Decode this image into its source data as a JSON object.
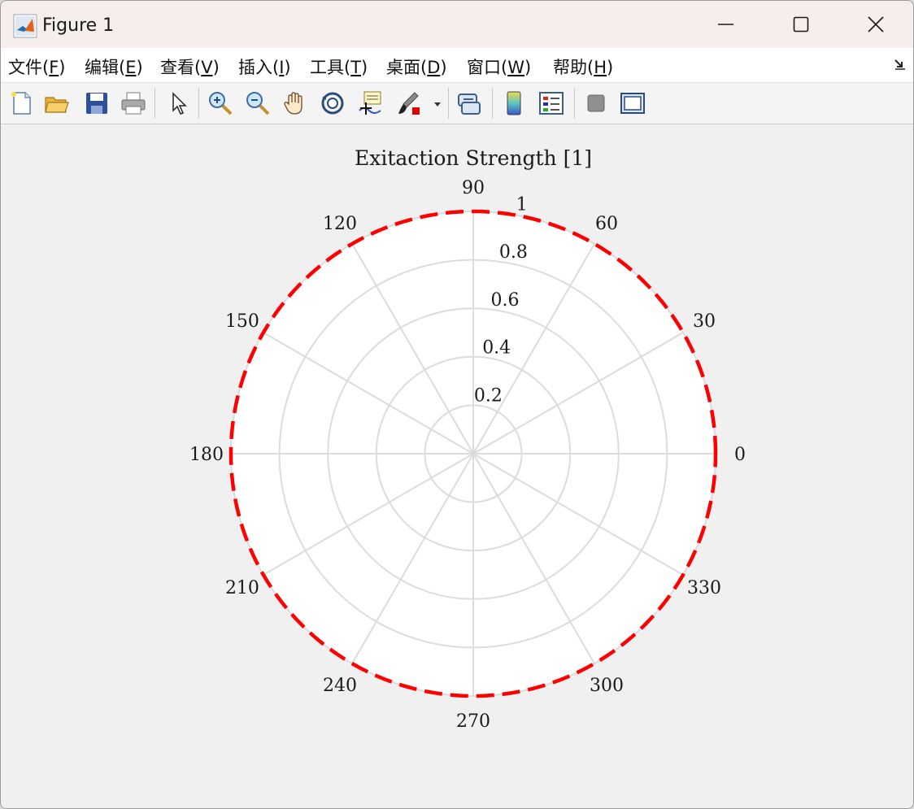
{
  "window": {
    "title": "Figure 1",
    "controls": {
      "minimize": "minimize",
      "maximize": "maximize",
      "close": "close"
    }
  },
  "menu": [
    {
      "prefix": "文件(",
      "key": "F",
      "suffix": ")"
    },
    {
      "prefix": "编辑(",
      "key": "E",
      "suffix": ")"
    },
    {
      "prefix": "查看(",
      "key": "V",
      "suffix": ")"
    },
    {
      "prefix": "插入(",
      "key": "I",
      "suffix": ")"
    },
    {
      "prefix": "工具(",
      "key": "T",
      "suffix": ")"
    },
    {
      "prefix": "桌面(",
      "key": "D",
      "suffix": ")"
    },
    {
      "prefix": "窗口(",
      "key": "W",
      "suffix": ")"
    },
    {
      "prefix": "帮助(",
      "key": "H",
      "suffix": ")"
    }
  ],
  "toolbar": {
    "buttons": [
      "new-figure-icon",
      "open-file-icon",
      "save-icon",
      "print-icon",
      "pointer-icon",
      "zoom-in-icon",
      "zoom-out-icon",
      "pan-icon",
      "rotate-3d-icon",
      "data-cursor-icon",
      "brush-icon",
      "brush-dropdown-icon",
      "link-plot-icon",
      "colorbar-icon",
      "legend-icon",
      "hide-plot-tools-icon",
      "show-plot-tools-icon"
    ]
  },
  "chart_data": {
    "type": "polar",
    "title": "Exitaction Strength [1]",
    "theta_ticks": [
      "0",
      "30",
      "60",
      "90",
      "120",
      "150",
      "180",
      "210",
      "240",
      "270",
      "300",
      "330"
    ],
    "theta_tick_values": [
      0,
      30,
      60,
      90,
      120,
      150,
      180,
      210,
      240,
      270,
      300,
      330
    ],
    "r_ticks": [
      "0.2",
      "0.4",
      "0.6",
      "0.8",
      "1"
    ],
    "r_tick_values": [
      0.2,
      0.4,
      0.6,
      0.8,
      1
    ],
    "rlim": [
      0,
      1
    ],
    "theta_unit": "degrees",
    "grid": true,
    "series": [
      {
        "style": "dashed",
        "color": "#ff0000",
        "theta_range_deg": [
          0,
          360
        ],
        "r": 1
      }
    ],
    "colors": {
      "grid": "#dcdcdc",
      "plot_bg": "#ffffff",
      "figure_bg": "#f0f0f0"
    }
  }
}
